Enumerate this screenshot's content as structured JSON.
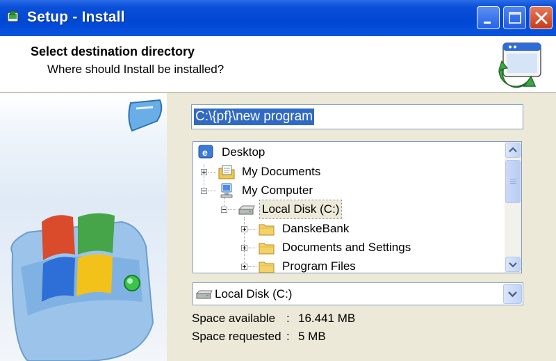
{
  "window": {
    "title": "Setup - Install",
    "buttons": [
      "minimize",
      "maximize",
      "close"
    ]
  },
  "header": {
    "title": "Select destination directory",
    "subtitle": "Where should Install be installed?",
    "icon": "setup-wizard-icon"
  },
  "path": {
    "value": "C:\\{pf}\\new program"
  },
  "tree": {
    "items": [
      {
        "label": "Desktop",
        "icon": "desktop-icon",
        "level": 0,
        "expander": "none"
      },
      {
        "label": "My Documents",
        "icon": "documents-icon",
        "level": 1,
        "expander": "plus"
      },
      {
        "label": "My Computer",
        "icon": "computer-icon",
        "level": 1,
        "expander": "minus"
      },
      {
        "label": "Local Disk (C:)",
        "icon": "drive-icon",
        "level": 2,
        "expander": "minus",
        "selected": true
      },
      {
        "label": "DanskeBank",
        "icon": "folder-icon",
        "level": 3,
        "expander": "plus"
      },
      {
        "label": "Documents and Settings",
        "icon": "folder-icon",
        "level": 3,
        "expander": "plus"
      },
      {
        "label": "Program Files",
        "icon": "folder-icon",
        "level": 3,
        "expander": "plus"
      }
    ]
  },
  "drive": {
    "selected": "Local Disk (C:)"
  },
  "space": {
    "available_label": "Space available",
    "available_value": "16.441 MB",
    "requested_label": "Space requested",
    "requested_value": "5 MB"
  },
  "colors": {
    "titlebar": "#0047d3",
    "selection": "#316ac5",
    "window_bg": "#ece9d8"
  }
}
